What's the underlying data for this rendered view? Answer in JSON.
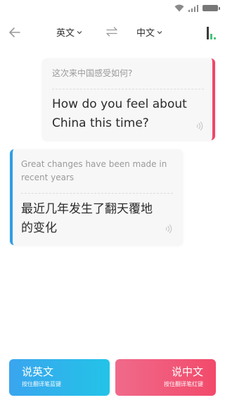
{
  "header": {
    "source_language": "英文",
    "target_language": "中文"
  },
  "messages": [
    {
      "side": "right",
      "original": "这次来中国感受如何?",
      "translation": "How do you feel about China this time?",
      "accent": "#f0476a"
    },
    {
      "side": "left",
      "original": "Great changes have been made in recent years",
      "translation": "最近几年发生了翻天覆地的变化",
      "accent": "#2f9ee6"
    }
  ],
  "buttons": {
    "speak_english": {
      "label": "说英文",
      "hint": "按住翻译笔蓝键",
      "color": "#3aa5ef"
    },
    "speak_chinese": {
      "label": "说中文",
      "hint": "按住翻译笔红键",
      "color": "#f24a6b"
    }
  },
  "icons": {
    "back": "back-arrow-icon",
    "swap": "swap-arrows-icon",
    "levels": "bars-icon",
    "speaker": "speaker-icon"
  }
}
